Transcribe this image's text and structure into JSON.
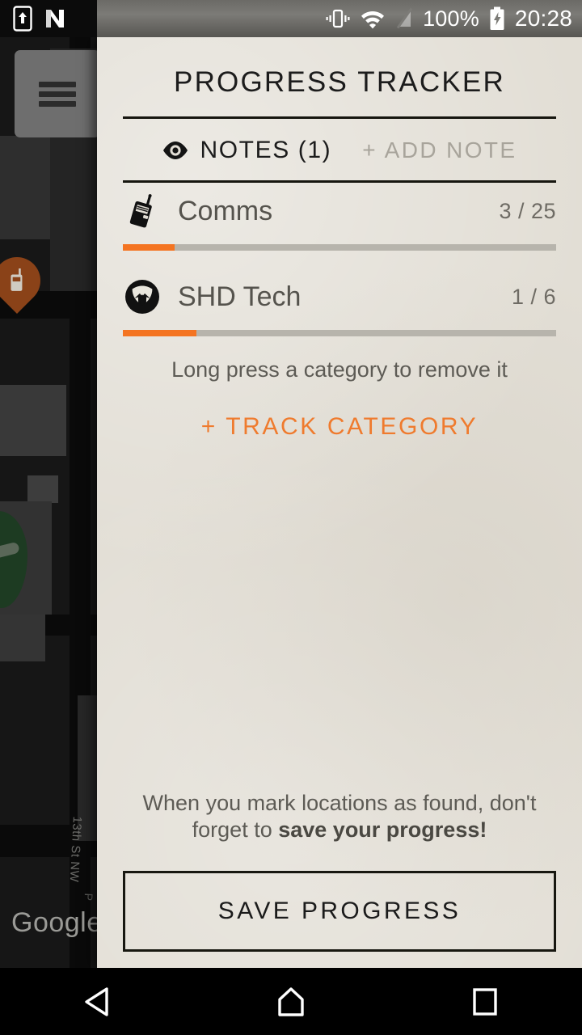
{
  "statusbar": {
    "left_icons": [
      "phone-upload-icon",
      "nova-launcher-icon"
    ],
    "right_icons": [
      "vibrate-icon",
      "wifi-icon",
      "no-signal-icon",
      "battery-charging-icon"
    ],
    "battery_percent": "100%",
    "clock": "20:28"
  },
  "map": {
    "menu_button": "menu-icon",
    "street_label": "13th St NW",
    "street_label_2": "P",
    "watermark": "Google",
    "pin_icon": "comms-pin-icon"
  },
  "drawer": {
    "title": "PROGRESS TRACKER",
    "notes": {
      "icon": "eye-icon",
      "label": "NOTES (1)",
      "add_label": "+ ADD NOTE"
    },
    "categories": [
      {
        "icon": "walkie-talkie-icon",
        "name": "Comms",
        "count": "3 / 25",
        "found": 3,
        "total": 25,
        "percent": 12
      },
      {
        "icon": "shd-tech-icon",
        "name": "SHD Tech",
        "count": "1 / 6",
        "found": 1,
        "total": 6,
        "percent": 17
      }
    ],
    "hint_remove": "Long press a category to remove it",
    "track_category": "+ TRACK CATEGORY",
    "save_hint_line1": "When you mark locations as found, don't",
    "save_hint_line2_prefix": "forget to ",
    "save_hint_line2_bold": "save your progress!",
    "save_button": "SAVE PROGRESS"
  },
  "navbar": {
    "back": "back-icon",
    "home": "home-icon",
    "recents": "recents-icon"
  },
  "colors": {
    "accent_orange": "#f47421",
    "paper": "#e2ded5",
    "track": "#b7b4ac",
    "text_dark": "#1c1c1c",
    "text_muted": "#5d5b55",
    "add_note_gray": "#a8a49b"
  }
}
